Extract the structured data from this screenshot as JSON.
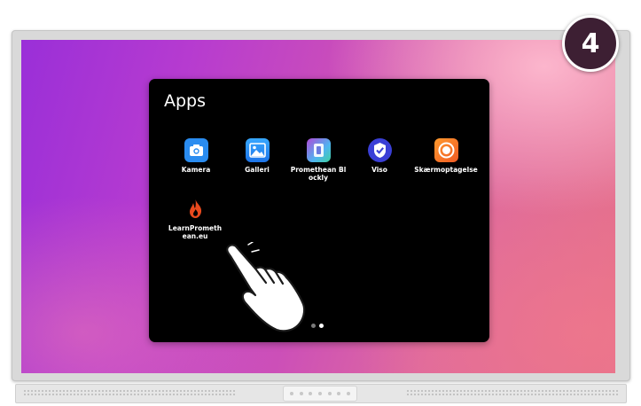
{
  "step_badge": {
    "number": "4"
  },
  "apps_panel": {
    "title": "Apps",
    "apps": [
      {
        "label": "Kamera",
        "icon": "camera-icon"
      },
      {
        "label": "Galleri",
        "icon": "gallery-icon"
      },
      {
        "label": "Promethean Blockly",
        "icon": "blockly-icon"
      },
      {
        "label": "Viso",
        "icon": "viso-shield-icon"
      },
      {
        "label": "Skærmoptagelse",
        "icon": "screen-record-icon"
      },
      {
        "label": "LearnPromethean.eu",
        "icon": "learn-flame-icon"
      }
    ],
    "pagination": {
      "current_page": 2,
      "total_pages": 2
    }
  },
  "colors": {
    "panel_bg": "#000000",
    "badge_bg": "#3d1f33",
    "wallpaper_start": "#9a2fd8",
    "wallpaper_end": "#e4708a"
  }
}
